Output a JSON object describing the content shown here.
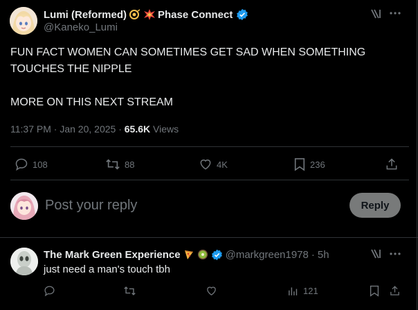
{
  "tweet": {
    "author_name": "Lumi (Reformed)",
    "author_name_suffix": "Phase Connect",
    "author_handle": "@Kaneko_Lumi",
    "text_line1": "FUN FACT WOMEN CAN SOMETIMES GET SAD WHEN SOMETHING",
    "text_line2": "TOUCHES THE NIPPLE",
    "text_line3": "MORE ON THIS NEXT STREAM",
    "time": "11:37 PM",
    "date": "Jan 20, 2025",
    "views_count": "65.6K",
    "views_label": "Views",
    "replies": "108",
    "reposts": "88",
    "likes": "4K",
    "bookmarks": "236"
  },
  "composer": {
    "placeholder": "Post your reply",
    "button_label": "Reply"
  },
  "reply": {
    "author_name": "The Mark Green Experience",
    "author_handle": "@markgreen1978",
    "separator": "·",
    "age": "5h",
    "text": "just need a man's touch tbh",
    "views": "121"
  },
  "colors": {
    "verified_blue": "#1d9bf0",
    "verified_gold": "#e0b03a",
    "icon_gray": "#71767b"
  }
}
